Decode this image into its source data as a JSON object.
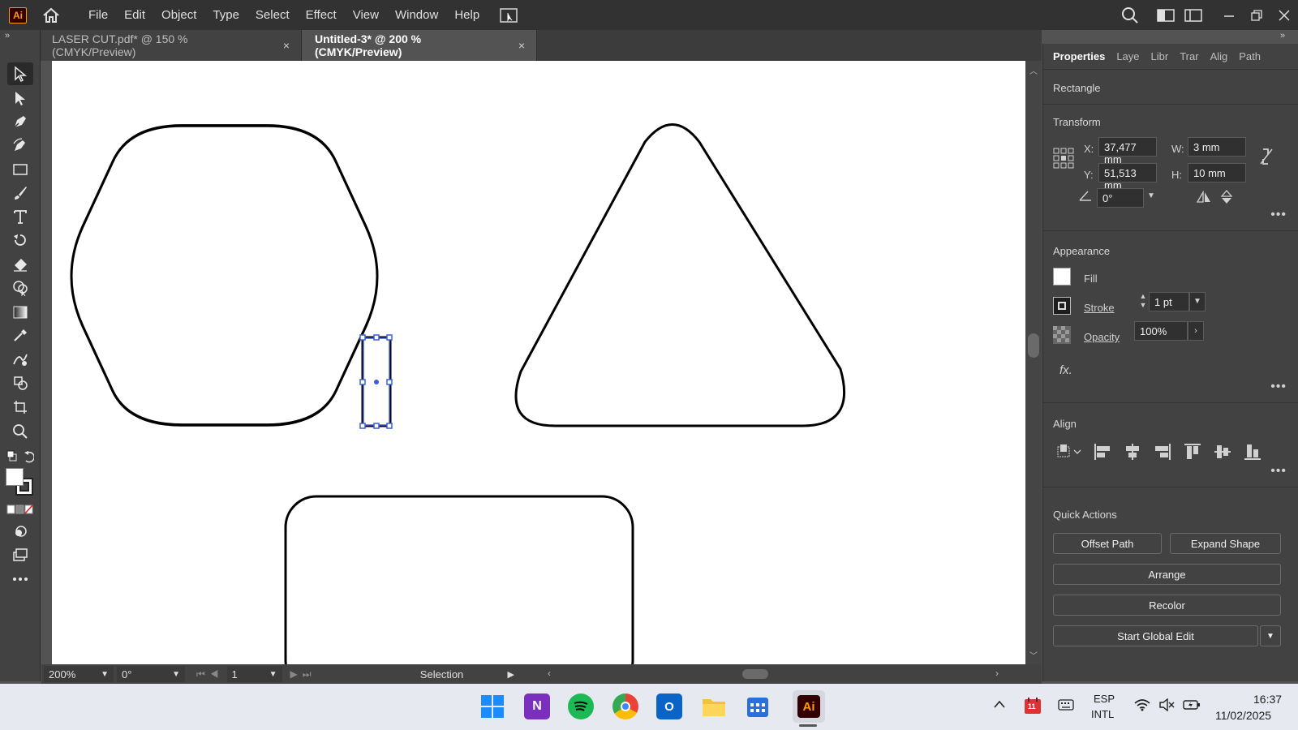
{
  "app": {
    "logo": "Ai",
    "menu": [
      "File",
      "Edit",
      "Object",
      "Type",
      "Select",
      "Effect",
      "View",
      "Window",
      "Help"
    ]
  },
  "tabs": [
    {
      "label": "LASER CUT.pdf* @ 150 % (CMYK/Preview)",
      "close": "×",
      "active": false
    },
    {
      "label": "Untitled-3* @ 200 % (CMYK/Preview)",
      "close": "×",
      "active": true
    }
  ],
  "status": {
    "zoom": "200%",
    "rotation": "0°",
    "artboard": "1",
    "tool": "Selection"
  },
  "properties": {
    "tabs": [
      "Properties",
      "Laye",
      "Libr",
      "Trar",
      "Alig",
      "Path"
    ],
    "object_type": "Rectangle",
    "transform": {
      "title": "Transform",
      "x_label": "X:",
      "x_value": "37,477 mm",
      "y_label": "Y:",
      "y_value": "51,513 mm",
      "w_label": "W:",
      "w_value": "3 mm",
      "h_label": "H:",
      "h_value": "10 mm",
      "angle_value": "0°"
    },
    "appearance": {
      "title": "Appearance",
      "fill_label": "Fill",
      "stroke_label": "Stroke",
      "stroke_value": "1 pt",
      "opacity_label": "Opacity",
      "opacity_value": "100%",
      "fx_label": "fx."
    },
    "align": {
      "title": "Align"
    },
    "quick_actions": {
      "title": "Quick Actions",
      "offset_path": "Offset Path",
      "expand_shape": "Expand Shape",
      "arrange": "Arrange",
      "recolor": "Recolor",
      "global_edit": "Start Global Edit"
    }
  },
  "taskbar": {
    "language_line1": "ESP",
    "language_line2": "INTL",
    "time": "16:37",
    "date": "11/02/2025",
    "notification_badge": "11"
  },
  "colors": {
    "selection": "#3d5fd6",
    "accent_ai": "#ff9a00"
  }
}
